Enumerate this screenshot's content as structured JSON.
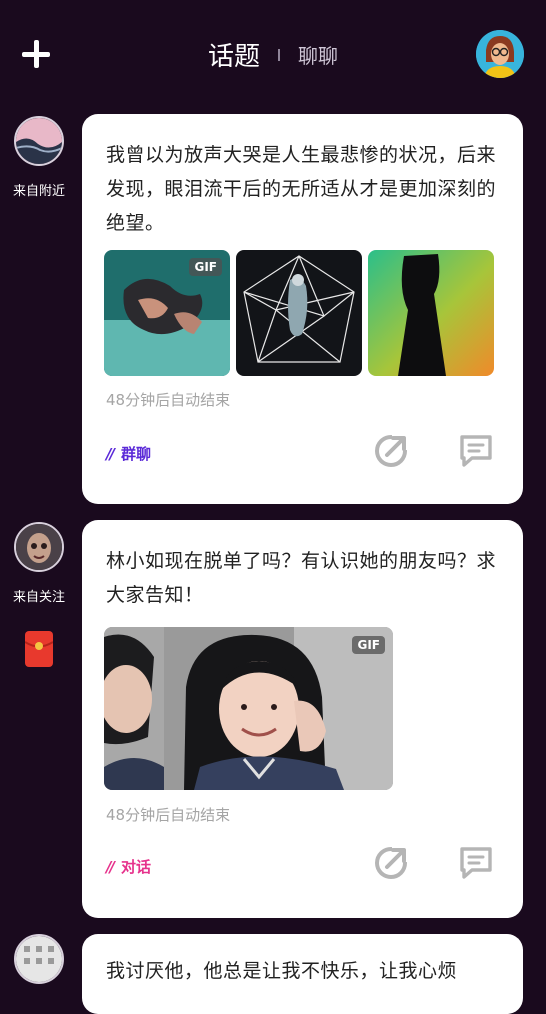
{
  "header": {
    "add_icon": "plus-icon",
    "tabs": [
      {
        "label": "话题",
        "active": true
      },
      {
        "label": "聊聊",
        "active": false
      }
    ]
  },
  "colors": {
    "background": "#1a0a1e",
    "group_tag": "#5b2ad8",
    "dialog_tag": "#e6328c",
    "hongbao": "#e8392d"
  },
  "feed": [
    {
      "source": "来自附近",
      "text": "我曾以为放声大哭是人生最悲惨的状况，后来发现，眼泪流干后的无所适从才是更加深刻的绝望。",
      "media_badge": "GIF",
      "expire": "48分钟后自动结束",
      "tag": "群聊"
    },
    {
      "source": "来自关注",
      "text": "林小如现在脱单了吗？有认识她的朋友吗？求大家告知！",
      "media_badge": "GIF",
      "expire": "48分钟后自动结束",
      "tag": "对话"
    },
    {
      "text": "我讨厌他，他总是让我不快乐，让我心烦"
    }
  ],
  "icons": {
    "share": "share-icon",
    "comment": "comment-icon",
    "hongbao": "red-envelope-icon"
  }
}
